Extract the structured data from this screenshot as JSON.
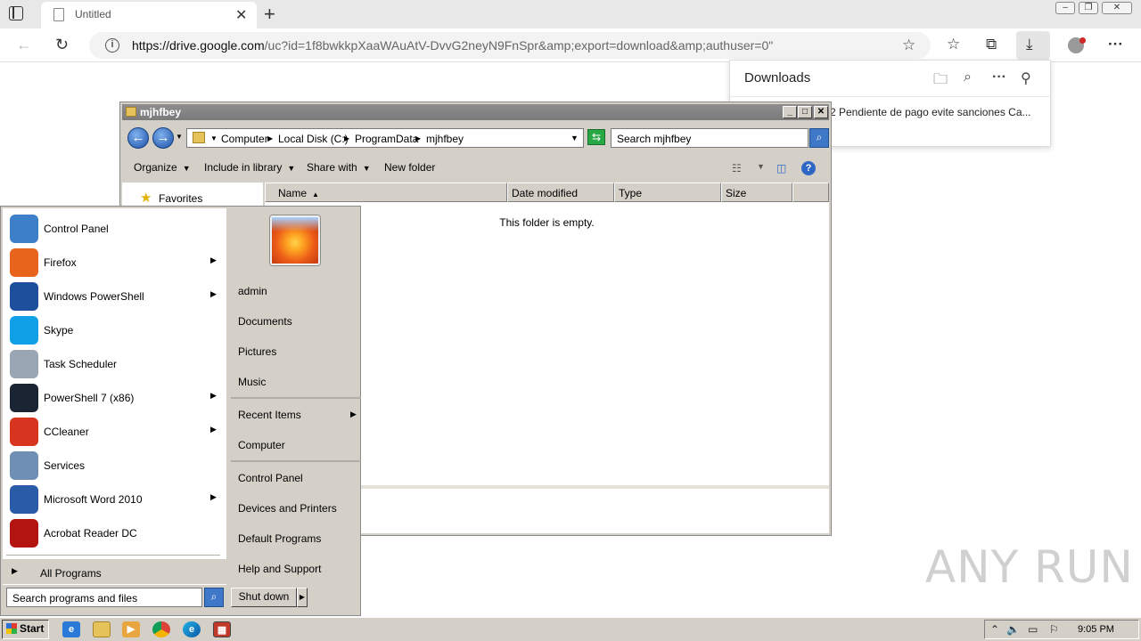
{
  "browser": {
    "tab_title": "Untitled",
    "url_host": "https://drive.google.com",
    "url_rest": "/uc?id=1f8bwkkpXaaWAuAtV-DvvG2neyN9FnSpr&amp;export=download&amp;authuser=0\"",
    "downloads": {
      "title": "Downloads",
      "item_text": "2 Pendiente de pago evite sanciones Ca..."
    }
  },
  "explorer": {
    "title": "mjhfbey",
    "breadcrumb": [
      "Computer",
      "Local Disk (C:)",
      "ProgramData",
      "mjhfbey"
    ],
    "search_placeholder": "Search mjhfbey",
    "toolbar": {
      "organize": "Organize",
      "include_in_library": "Include in library",
      "share_with": "Share with",
      "new_folder": "New folder"
    },
    "nav_pane": {
      "favorites": "Favorites"
    },
    "columns": [
      "Name",
      "Date modified",
      "Type",
      "Size"
    ],
    "empty_message": "This folder is empty."
  },
  "start_menu": {
    "programs": [
      {
        "label": "Control Panel",
        "icon": "control-panel-icon",
        "color": "#3d7fc8",
        "has_submenu": false
      },
      {
        "label": "Firefox",
        "icon": "firefox-icon",
        "color": "#e8631c",
        "has_submenu": true
      },
      {
        "label": "Windows PowerShell",
        "icon": "powershell-icon",
        "color": "#1e4f9c",
        "has_submenu": true
      },
      {
        "label": "Skype",
        "icon": "skype-icon",
        "color": "#10a0e8",
        "has_submenu": false
      },
      {
        "label": "Task Scheduler",
        "icon": "clock-icon",
        "color": "#9aa6b4",
        "has_submenu": false
      },
      {
        "label": "PowerShell 7 (x86)",
        "icon": "powershell7-icon",
        "color": "#1a2433",
        "has_submenu": true
      },
      {
        "label": "CCleaner",
        "icon": "ccleaner-icon",
        "color": "#d7351f",
        "has_submenu": true
      },
      {
        "label": "Services",
        "icon": "gears-icon",
        "color": "#6f8fb4",
        "has_submenu": false
      },
      {
        "label": "Microsoft Word 2010",
        "icon": "word-icon",
        "color": "#2a5ba8",
        "has_submenu": true
      },
      {
        "label": "Acrobat Reader DC",
        "icon": "acrobat-icon",
        "color": "#b3140f",
        "has_submenu": false
      }
    ],
    "all_programs": "All Programs",
    "search_placeholder": "Search programs and files",
    "right": {
      "user": "admin",
      "documents": "Documents",
      "pictures": "Pictures",
      "music": "Music",
      "recent_items": "Recent Items",
      "computer": "Computer",
      "control_panel": "Control Panel",
      "devices_printers": "Devices and Printers",
      "default_programs": "Default Programs",
      "help_support": "Help and Support"
    },
    "shutdown": "Shut down"
  },
  "taskbar": {
    "start": "Start",
    "clock": "9:05 PM"
  },
  "watermark": "ANY RUN"
}
